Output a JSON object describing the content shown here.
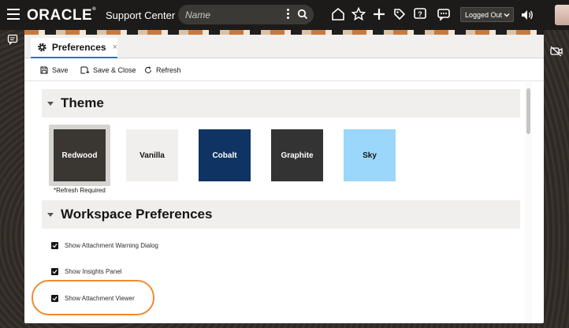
{
  "navbar": {
    "brand": "ORACLE",
    "brand_mark": "®",
    "app_title": "Support Center",
    "search_placeholder": "Name",
    "status_value": "Logged Out"
  },
  "tab": {
    "label": "Preferences",
    "close": "×"
  },
  "toolbar": {
    "save": "Save",
    "save_close": "Save & Close",
    "refresh": "Refresh"
  },
  "theme": {
    "title": "Theme",
    "options": [
      {
        "label": "Redwood",
        "bg": "#3a3631",
        "fg": "#ffffff"
      },
      {
        "label": "Vanilla",
        "bg": "#f0efed",
        "fg": "#161513"
      },
      {
        "label": "Cobalt",
        "bg": "#0f3362",
        "fg": "#ffffff"
      },
      {
        "label": "Graphite",
        "bg": "#333333",
        "fg": "#ffffff"
      },
      {
        "label": "Sky",
        "bg": "#9ad7fb",
        "fg": "#161513"
      }
    ],
    "selected": "Redwood",
    "refresh_note": "*Refresh Required"
  },
  "workspace": {
    "title": "Workspace Preferences",
    "options": [
      {
        "label": "Show Attachment Warning Dialog",
        "checked": true
      },
      {
        "label": "Show Insights Panel",
        "checked": true
      },
      {
        "label": "Show Attachment Viewer",
        "checked": true
      }
    ]
  },
  "colors": {
    "accent": "#2c72c4",
    "highlight": "#f08a32",
    "navbar": "#1c1b1a"
  }
}
